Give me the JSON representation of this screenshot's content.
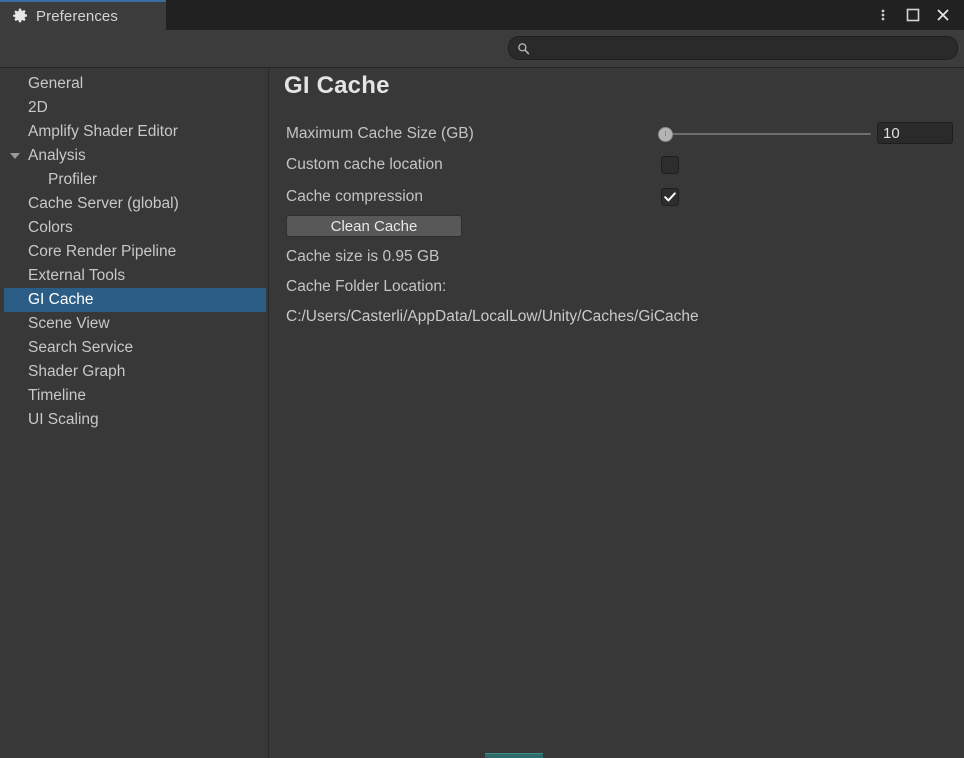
{
  "window": {
    "tab_label": "Preferences",
    "tab_icon": "gear-icon",
    "accent_color": "#3a6d9e",
    "controls": [
      {
        "name": "more-options-button",
        "icon": "kebab-menu-icon"
      },
      {
        "name": "maximize-button",
        "icon": "maximize-icon"
      },
      {
        "name": "close-button",
        "icon": "close-icon"
      }
    ]
  },
  "search": {
    "icon": "search-icon",
    "value": "",
    "placeholder": ""
  },
  "sidebar": {
    "selected": "GI Cache",
    "selection_color": "#2c5d87",
    "items": [
      {
        "label": "General",
        "level": 0,
        "expandable": false
      },
      {
        "label": "2D",
        "level": 0,
        "expandable": false
      },
      {
        "label": "Amplify Shader Editor",
        "level": 0,
        "expandable": false
      },
      {
        "label": "Analysis",
        "level": 0,
        "expandable": true,
        "expanded": true
      },
      {
        "label": "Profiler",
        "level": 1,
        "expandable": false
      },
      {
        "label": "Cache Server (global)",
        "level": 0,
        "expandable": false
      },
      {
        "label": "Colors",
        "level": 0,
        "expandable": false
      },
      {
        "label": "Core Render Pipeline",
        "level": 0,
        "expandable": false
      },
      {
        "label": "External Tools",
        "level": 0,
        "expandable": false
      },
      {
        "label": "GI Cache",
        "level": 0,
        "expandable": false,
        "selected": true
      },
      {
        "label": "Scene View",
        "level": 0,
        "expandable": false
      },
      {
        "label": "Search Service",
        "level": 0,
        "expandable": false
      },
      {
        "label": "Shader Graph",
        "level": 0,
        "expandable": false
      },
      {
        "label": "Timeline",
        "level": 0,
        "expandable": false
      },
      {
        "label": "UI Scaling",
        "level": 0,
        "expandable": false
      }
    ]
  },
  "main": {
    "title": "GI Cache",
    "max_cache_size": {
      "label": "Maximum Cache Size (GB)",
      "value": "10",
      "slider_percent": 3
    },
    "custom_cache_location": {
      "label": "Custom cache location",
      "checked": false
    },
    "cache_compression": {
      "label": "Cache compression",
      "checked": true
    },
    "clean_cache_button": "Clean Cache",
    "cache_size_text": "Cache size is 0.95 GB",
    "cache_folder_label": "Cache Folder Location:",
    "cache_folder_path": "C:/Users/Casterli/AppData/LocalLow/Unity/Caches/GiCache"
  }
}
